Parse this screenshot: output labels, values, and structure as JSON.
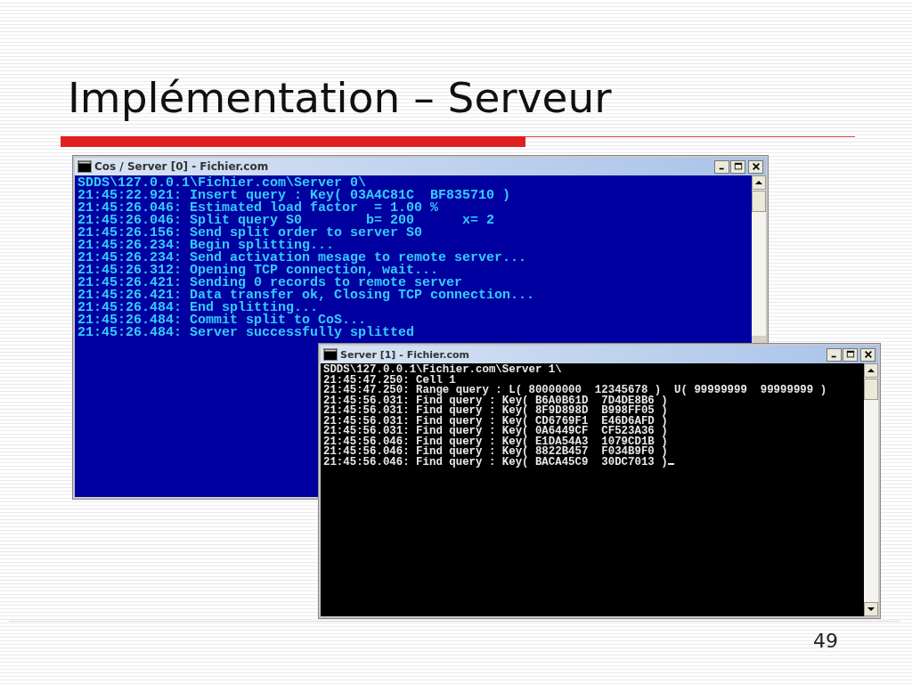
{
  "slide": {
    "title": "Implémentation – Serveur",
    "page_number": "49"
  },
  "windows": [
    {
      "title": "Cos / Server [0] - Fichier.com",
      "kind": "blue",
      "cursor": false,
      "lines": [
        "SDDS\\127.0.0.1\\Fichier.com\\Server 0\\",
        "21:45:22.921: Insert query : Key( 03A4C81C  BF835710 )",
        "21:45:26.046: Estimated load factor  = 1.00 %",
        "21:45:26.046: Split query S0        b= 200      x= 2",
        "21:45:26.156: Send split order to server S0",
        "21:45:26.234: Begin splitting...",
        "21:45:26.234: Send activation mesage to remote server...",
        "21:45:26.312: Opening TCP connection, wait...",
        "21:45:26.421: Sending 0 records to remote server",
        "21:45:26.421: Data transfer ok, Closing TCP connection...",
        "21:45:26.484: End splitting...",
        "21:45:26.484: Commit split to CoS...",
        "21:45:26.484: Server successfully splitted"
      ]
    },
    {
      "title": "Server [1] - Fichier.com",
      "kind": "black",
      "cursor": true,
      "lines": [
        "SDDS\\127.0.0.1\\Fichier.com\\Server 1\\",
        "21:45:47.250: Cell 1",
        "21:45:47.250: Range query : L( 80000000  12345678 )  U( 99999999  99999999 )",
        "21:45:56.031: Find query : Key( B6A0B61D  7D4DE8B6 )",
        "21:45:56.031: Find query : Key( 8F9D898D  B998FF05 )",
        "21:45:56.031: Find query : Key( CD6769F1  E46D6AFD )",
        "21:45:56.031: Find query : Key( 0A6449CF  CF523A36 )",
        "21:45:56.046: Find query : Key( E1DA54A3  1079CD1B )",
        "21:45:56.046: Find query : Key( 8822B457  F034B9F0 )",
        "21:45:56.046: Find query : Key( BACA45C9  30DC7013 )"
      ]
    }
  ]
}
